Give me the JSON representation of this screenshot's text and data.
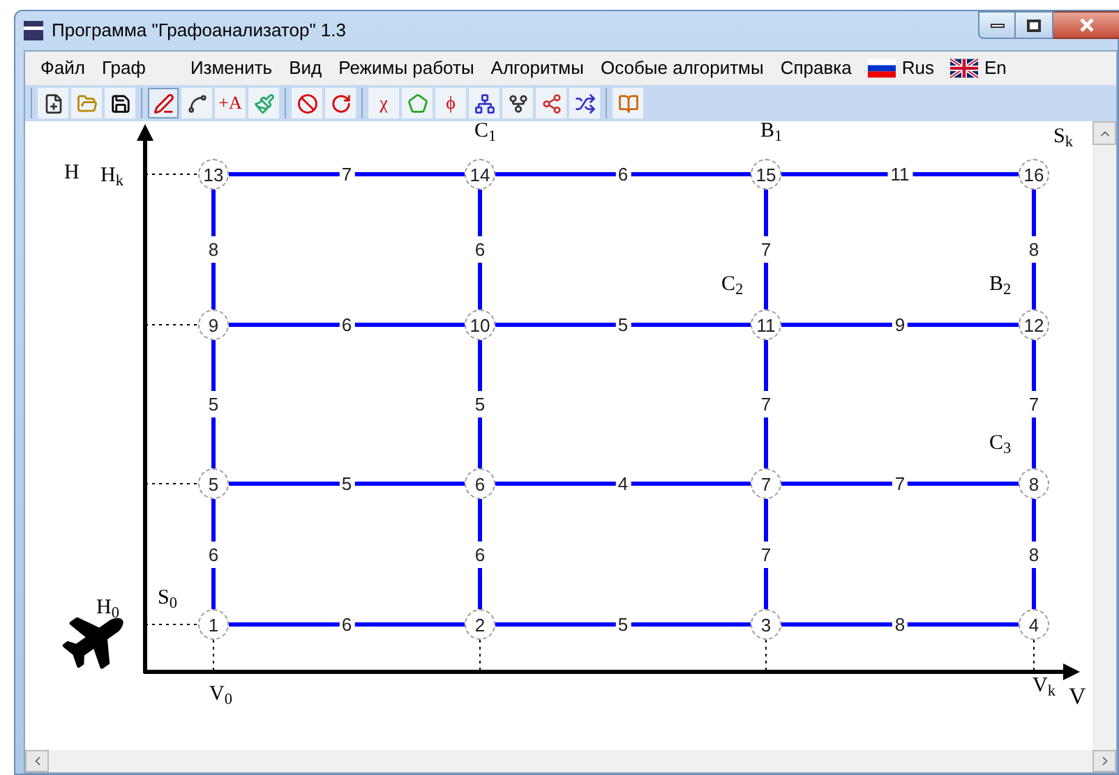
{
  "window": {
    "title": "Программа \"Графоанализатор\" 1.3"
  },
  "menu": [
    {
      "kind": "menu",
      "label": "Файл"
    },
    {
      "kind": "menu",
      "label": "Граф"
    },
    {
      "kind": "menu",
      "label": "Изменить"
    },
    {
      "kind": "menu",
      "label": "Вид"
    },
    {
      "kind": "menu",
      "label": "Режимы работы"
    },
    {
      "kind": "menu",
      "label": "Алгоритмы"
    },
    {
      "kind": "menu",
      "label": "Особые алгоритмы"
    },
    {
      "kind": "menu",
      "label": "Справка"
    },
    {
      "kind": "lang",
      "label": "Rus"
    },
    {
      "kind": "lang",
      "label": "En"
    }
  ],
  "toolbar": [
    [
      {
        "kind": "icon",
        "selected": false
      },
      {
        "kind": "icon",
        "selected": false
      },
      {
        "kind": "icon",
        "selected": false
      }
    ],
    [
      {
        "kind": "icon",
        "selected": true
      },
      {
        "kind": "icon",
        "selected": false
      },
      {
        "kind": "glyph",
        "text": "+A",
        "selected": false
      },
      {
        "kind": "icon",
        "selected": false
      }
    ],
    [
      {
        "kind": "icon",
        "selected": false
      },
      {
        "kind": "icon",
        "selected": false
      }
    ],
    [
      {
        "kind": "glyph",
        "text": "χ",
        "selected": false
      },
      {
        "kind": "icon",
        "selected": false
      },
      {
        "kind": "glyph",
        "text": "ϕ",
        "selected": false
      },
      {
        "kind": "icon",
        "selected": false
      },
      {
        "kind": "icon",
        "selected": false
      },
      {
        "kind": "icon",
        "selected": false
      },
      {
        "kind": "icon",
        "selected": false
      }
    ],
    [
      {
        "kind": "icon",
        "selected": false
      }
    ]
  ],
  "graph": [
    {
      "kind": "nodes",
      "items": [
        {
          "kind": "node",
          "label": "13"
        },
        {
          "kind": "edge",
          "label": "7"
        },
        {
          "kind": "node",
          "label": "14",
          "mark": "C$_{1}$"
        },
        {
          "kind": "edge",
          "label": "6"
        },
        {
          "kind": "node",
          "label": "15",
          "mark": "B$_{1}$"
        },
        {
          "kind": "edge",
          "label": "11"
        },
        {
          "kind": "node",
          "label": "16",
          "mark": "S$_{k}$"
        }
      ]
    },
    {
      "kind": "links",
      "items": [
        "8",
        "6",
        "7",
        "8"
      ]
    },
    {
      "kind": "nodes",
      "items": [
        {
          "kind": "node",
          "label": "9"
        },
        {
          "kind": "edge",
          "label": "6"
        },
        {
          "kind": "node",
          "label": "10"
        },
        {
          "kind": "edge",
          "label": "5"
        },
        {
          "kind": "node",
          "label": "11",
          "mark": "C$_{2}$"
        },
        {
          "kind": "edge",
          "label": "9"
        },
        {
          "kind": "node",
          "label": "12",
          "mark": "B$_{2}$"
        }
      ]
    },
    {
      "kind": "links",
      "items": [
        "5",
        "5",
        "7",
        "7"
      ]
    },
    {
      "kind": "nodes",
      "items": [
        {
          "kind": "node",
          "label": "5"
        },
        {
          "kind": "edge",
          "label": "5"
        },
        {
          "kind": "node",
          "label": "6"
        },
        {
          "kind": "edge",
          "label": "4"
        },
        {
          "kind": "node",
          "label": "7"
        },
        {
          "kind": "edge",
          "label": "7"
        },
        {
          "kind": "node",
          "label": "8",
          "mark": "C$_{3}$"
        }
      ]
    },
    {
      "kind": "links",
      "items": [
        "6",
        "6",
        "7",
        "8"
      ]
    },
    {
      "kind": "nodes",
      "items": [
        {
          "kind": "node",
          "label": "1",
          "mark": "S$_{0}$"
        },
        {
          "kind": "edge",
          "label": "6"
        },
        {
          "kind": "node",
          "label": "2"
        },
        {
          "kind": "edge",
          "label": "5"
        },
        {
          "kind": "node",
          "label": "3"
        },
        {
          "kind": "edge",
          "label": "8"
        },
        {
          "kind": "node",
          "label": "4"
        }
      ]
    }
  ],
  "axes": {
    "y_label": "H",
    "y_top": "H$_{k}$",
    "y_bottom": "H$_{0}$",
    "x_left": "V$_{0}$",
    "x_right": "V$_{k}$",
    "x_label": "V"
  }
}
